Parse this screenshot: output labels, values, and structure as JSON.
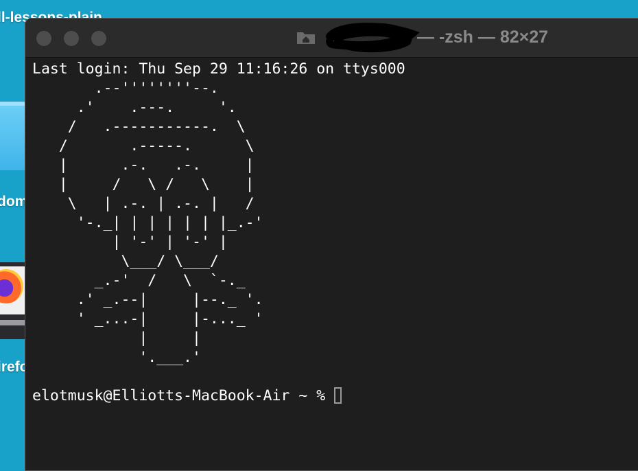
{
  "desktop": {
    "labels": [
      "ll-lessons-plain",
      "dom",
      "irefo"
    ]
  },
  "terminal": {
    "title": "— -zsh — 82×27",
    "last_login": "Last login: Thu Sep 29 11:16:26 on ttys000",
    "ascii_art": [
      "    .--''''''''--.",
      "  .'    .---.     '.",
      " /   .-----------.  \\",
      "/       .-----.      \\",
      "|      .-.   .-.     |",
      "|     /   \\ /   \\    |",
      " \\   | .-. | .-. |   /",
      "  '-._| | | | | | |_.-'",
      "      | '-' | '-' |",
      "       \\___/ \\___/",
      "    _.-'  /   \\  `-._",
      "  .' _.--|     |--._ '.",
      "  ' _...-|     |-..._ '",
      "         |     |",
      "         '.___.'"
    ],
    "prompt": "elotmusk@Elliotts-MacBook-Air ~ % "
  }
}
